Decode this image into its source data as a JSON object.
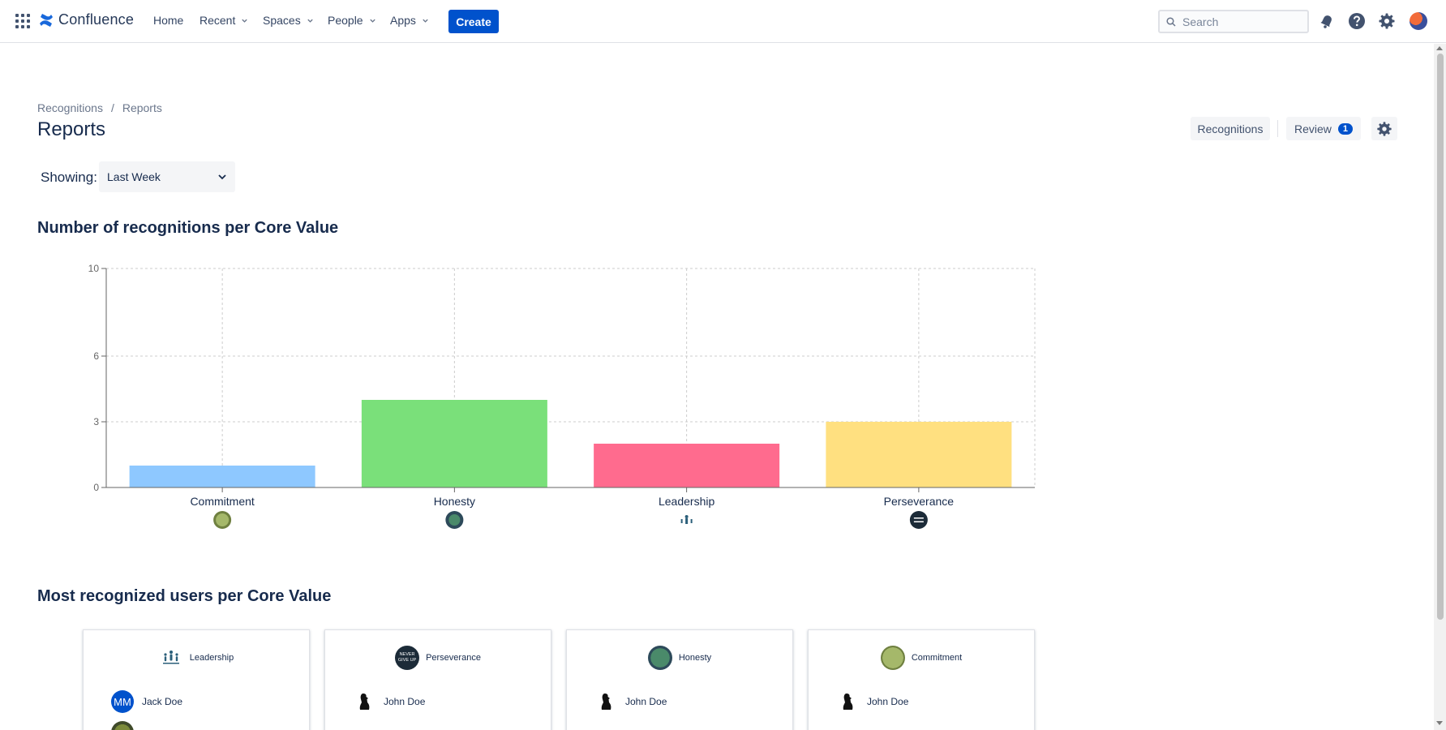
{
  "nav": {
    "logo_text": "Confluence",
    "items": [
      {
        "label": "Home",
        "dropdown": false
      },
      {
        "label": "Recent",
        "dropdown": true
      },
      {
        "label": "Spaces",
        "dropdown": true
      },
      {
        "label": "People",
        "dropdown": true
      },
      {
        "label": "Apps",
        "dropdown": true
      }
    ],
    "create_label": "Create",
    "search_placeholder": "Search"
  },
  "breadcrumb": {
    "items": [
      "Recognitions",
      "Reports"
    ],
    "separator": "/"
  },
  "page": {
    "title": "Reports",
    "recognitions_button": "Recognitions",
    "review_button": "Review",
    "review_count": "1"
  },
  "filter": {
    "label": "Showing:",
    "selected": "Last Week"
  },
  "sections": {
    "chart_title": "Number of recognitions per Core Value",
    "users_title": "Most recognized users per Core Value"
  },
  "chart_data": {
    "type": "bar",
    "categories": [
      "Commitment",
      "Honesty",
      "Leadership",
      "Perseverance"
    ],
    "values": [
      1,
      4,
      2,
      3
    ],
    "colors": [
      "#8ec8ff",
      "#7ae07a",
      "#ff6b8e",
      "#ffe080"
    ],
    "yticks": [
      0,
      3,
      6,
      10
    ],
    "ylim": [
      0,
      10
    ],
    "grid": true,
    "title": "",
    "xlabel": "",
    "ylabel": ""
  },
  "cards": [
    {
      "core_value": "Leadership",
      "icon": "leadership-icon",
      "users": [
        {
          "name": "Jack Doe",
          "initials": "MM"
        }
      ]
    },
    {
      "core_value": "Perseverance",
      "icon": "perseverance-icon",
      "icon_text_1": "NEVER",
      "icon_text_2": "GIVE UP",
      "users": [
        {
          "name": "John Doe"
        }
      ]
    },
    {
      "core_value": "Honesty",
      "icon": "honesty-icon",
      "users": [
        {
          "name": "John Doe"
        }
      ]
    },
    {
      "core_value": "Commitment",
      "icon": "commitment-icon",
      "users": [
        {
          "name": "John Doe"
        }
      ]
    }
  ],
  "colors": {
    "primary": "#0052cc",
    "text": "#172b4d",
    "subtle": "#6b778c",
    "button_bg": "#f4f5f7"
  }
}
